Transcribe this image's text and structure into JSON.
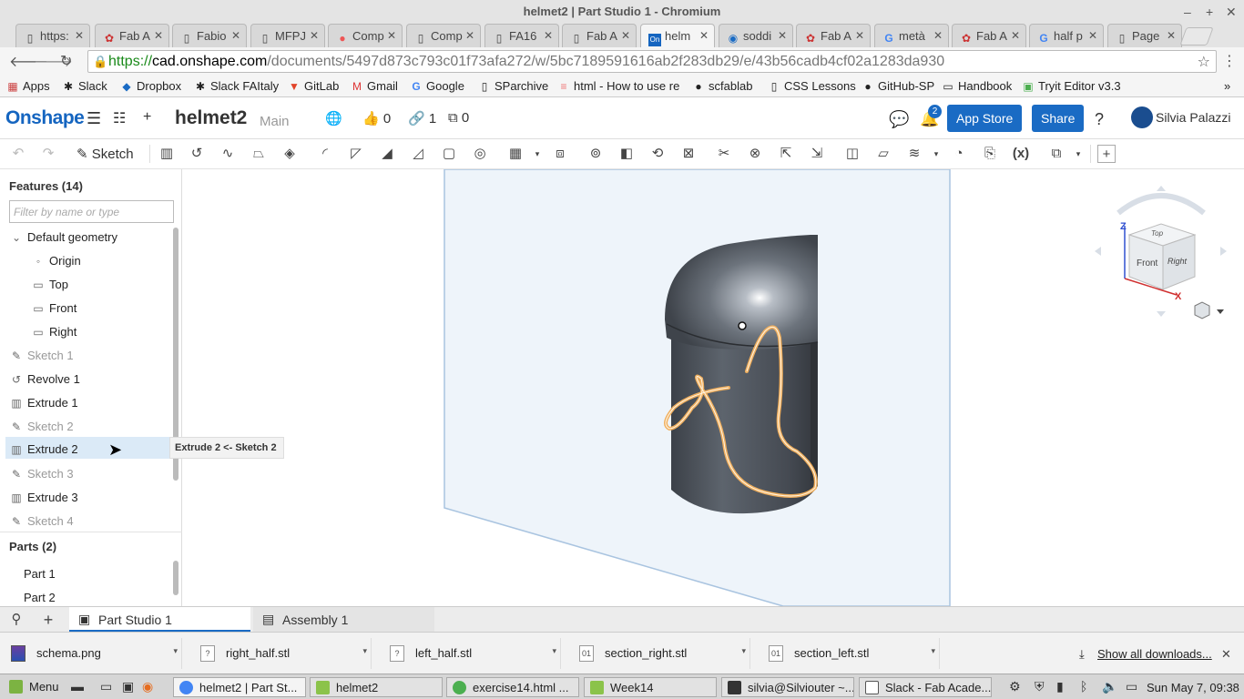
{
  "window": {
    "title": "helmet2 | Part Studio 1 - Chromium"
  },
  "tabs": [
    {
      "label": "https:",
      "icon": "page-icon"
    },
    {
      "label": "Fab A",
      "icon": "fab-icon"
    },
    {
      "label": "Fabio",
      "icon": "page-icon"
    },
    {
      "label": "MFPJ",
      "icon": "page-icon"
    },
    {
      "label": "Comp",
      "icon": "photos-icon"
    },
    {
      "label": "Comp",
      "icon": "page-icon"
    },
    {
      "label": "FA16",
      "icon": "page-icon"
    },
    {
      "label": "Fab A",
      "icon": "page-icon"
    },
    {
      "label": "helm",
      "icon": "onshape-icon"
    },
    {
      "label": "soddi",
      "icon": "chat-icon"
    },
    {
      "label": "Fab A",
      "icon": "fab-icon"
    },
    {
      "label": "metà",
      "icon": "google-icon"
    },
    {
      "label": "Fab A",
      "icon": "fab-icon"
    },
    {
      "label": "half p",
      "icon": "google-icon"
    },
    {
      "label": "Page",
      "icon": "page-icon"
    }
  ],
  "address": {
    "scheme": "https://",
    "host": "cad.onshape.com",
    "path": "/documents/5497d873c793c01f73afa272/w/5bc7189591616ab2f283db29/e/43b56cadb4cf02a1283da930"
  },
  "bookmarks": [
    "Apps",
    "Slack",
    "Dropbox",
    "Slack FAItaly",
    "GitLab",
    "Gmail",
    "Google",
    "SParchive",
    "html - How to use re",
    "scfablab",
    "CSS Lessons",
    "GitHub-SP",
    "Handbook",
    "Tryit Editor v3.3"
  ],
  "header": {
    "logo": "Onshape",
    "doc_name": "helmet2",
    "branch": "Main",
    "likes": "0",
    "links": "1",
    "copies": "0",
    "notifications": "2",
    "app_store": "App Store",
    "share": "Share",
    "user": "Silvia Palazzi"
  },
  "toolbar": {
    "sketch_label": "Sketch"
  },
  "features": {
    "title": "Features (14)",
    "filter_placeholder": "Filter by name or type",
    "items": [
      {
        "label": "Default geometry",
        "icon": "chevron-down-icon"
      },
      {
        "label": "Origin",
        "icon": "origin-icon"
      },
      {
        "label": "Top",
        "icon": "plane-icon"
      },
      {
        "label": "Front",
        "icon": "plane-icon"
      },
      {
        "label": "Right",
        "icon": "plane-icon"
      },
      {
        "label": "Sketch 1",
        "icon": "sketch-icon"
      },
      {
        "label": "Revolve 1",
        "icon": "revolve-icon"
      },
      {
        "label": "Extrude 1",
        "icon": "extrude-icon"
      },
      {
        "label": "Sketch 2",
        "icon": "sketch-icon"
      },
      {
        "label": "Extrude 2",
        "icon": "extrude-icon"
      },
      {
        "label": "Sketch 3",
        "icon": "sketch-icon"
      },
      {
        "label": "Extrude 3",
        "icon": "extrude-icon"
      },
      {
        "label": "Sketch 4",
        "icon": "sketch-icon"
      }
    ],
    "tooltip": "Extrude 2 <- Sketch 2"
  },
  "parts": {
    "title": "Parts (2)",
    "items": [
      "Part 1",
      "Part 2"
    ]
  },
  "viewcube": {
    "top": "Top",
    "front": "Front",
    "right": "Right",
    "axis_z": "Z",
    "axis_x": "X"
  },
  "bottom_tabs": [
    "Part Studio 1",
    "Assembly 1"
  ],
  "downloads": {
    "files": [
      "schema.png",
      "right_half.stl",
      "left_half.stl",
      "section_right.stl",
      "section_left.stl"
    ],
    "show_all": "Show all downloads..."
  },
  "taskbar": {
    "menu": "Menu",
    "windows": [
      "helmet2 | Part St...",
      "helmet2",
      "exercise14.html ...",
      "Week14",
      "silvia@Silviouter ~...",
      "Slack - Fab Acade..."
    ],
    "clock": "Sun May  7, 09:38"
  },
  "colors": {
    "accent": "#1a6bc4",
    "sketch_curve": "#f0b060"
  }
}
